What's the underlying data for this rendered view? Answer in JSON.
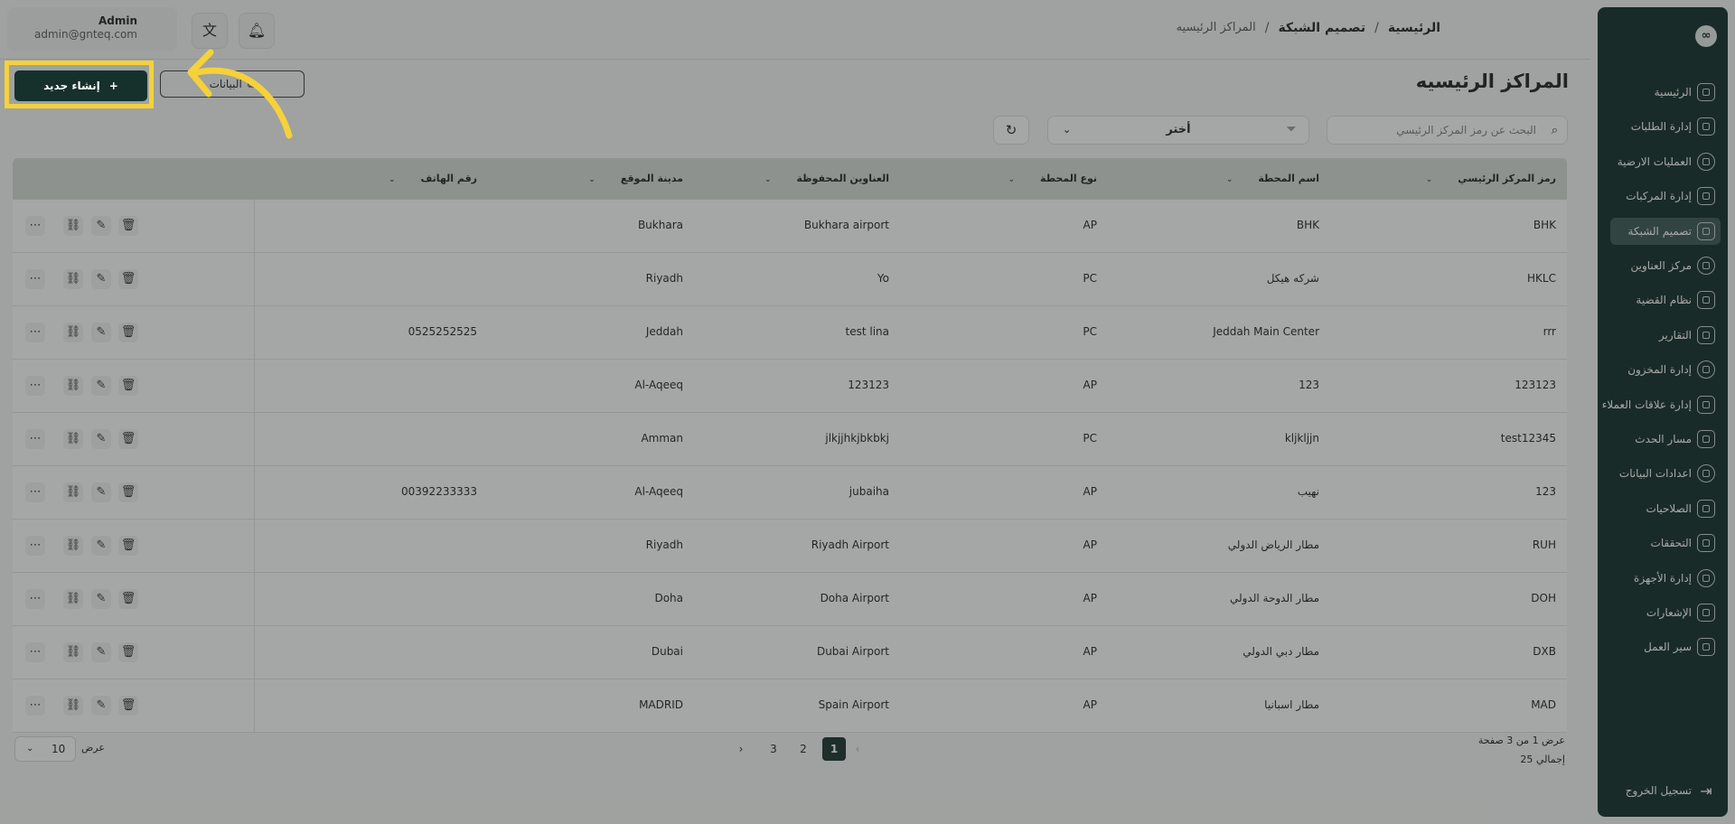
{
  "sidebar": {
    "logo": "∞",
    "items": [
      {
        "label": "الرئيسية",
        "icon": "dashboard-icon",
        "active": false
      },
      {
        "label": "إدارة الطلبات",
        "icon": "orders-icon",
        "active": false
      },
      {
        "label": "العمليات الارضية",
        "icon": "ground-ops-icon",
        "active": false
      },
      {
        "label": "إدارة المركبات",
        "icon": "truck-icon",
        "active": false
      },
      {
        "label": "تصميم الشبكة",
        "icon": "network-icon",
        "active": true
      },
      {
        "label": "مركز العناوين",
        "icon": "location-icon",
        "active": false
      },
      {
        "label": "نظام القضية",
        "icon": "case-icon",
        "active": false
      },
      {
        "label": "التقارير",
        "icon": "reports-icon",
        "active": false
      },
      {
        "label": "إدارة المخزون",
        "icon": "inventory-icon",
        "active": false
      },
      {
        "label": "إدارة علاقات العملاء",
        "icon": "crm-icon",
        "active": false
      },
      {
        "label": "مسار الحدث",
        "icon": "route-icon",
        "active": false
      },
      {
        "label": "اعدادات البيانات",
        "icon": "database-icon",
        "active": false
      },
      {
        "label": "الصلاحيات",
        "icon": "users-icon",
        "active": false
      },
      {
        "label": "التحققات",
        "icon": "tools-icon",
        "active": false
      },
      {
        "label": "إدارة الأجهزة",
        "icon": "devices-icon",
        "active": false
      },
      {
        "label": "الإشعارات",
        "icon": "bell-icon",
        "active": false
      },
      {
        "label": "سير العمل",
        "icon": "workflow-icon",
        "active": false
      }
    ],
    "logout": "تسجيل الخروج"
  },
  "header": {
    "user_name": "Admin",
    "user_email": "admin@gnteq.com",
    "breadcrumb": [
      "الرئيسية",
      "تصميم الشبكة",
      "المراكز الرئيسيه"
    ]
  },
  "page": {
    "title": "المراكز الرئيسيه",
    "create_label": "إنشاء جديد",
    "import_label": "البيانات"
  },
  "filters": {
    "search_placeholder": "البحث عن رمز المركز الرئيسي",
    "select_value": "أختر"
  },
  "table": {
    "columns": [
      "رمز المركز الرئيسي",
      "اسم المحطة",
      "نوع المحطة",
      "العناوين المحفوظة",
      "مدينة الموقع",
      "رقم الهاتف"
    ],
    "rows": [
      {
        "code": "BHK",
        "name": "BHK",
        "type": "AP",
        "address": "Bukhara airport",
        "city": "Bukhara",
        "phone": ""
      },
      {
        "code": "HKLC",
        "name": "شركه هيكل",
        "type": "PC",
        "address": "Yo",
        "city": "Riyadh",
        "phone": ""
      },
      {
        "code": "rrr",
        "name": "Jeddah Main Center",
        "type": "PC",
        "address": "test lina",
        "city": "Jeddah",
        "phone": "0525252525"
      },
      {
        "code": "123123",
        "name": "123",
        "type": "AP",
        "address": "123123",
        "city": "Al-Aqeeq",
        "phone": ""
      },
      {
        "code": "test12345",
        "name": "kljkljjn",
        "type": "PC",
        "address": "jlkjjhkjbkbkj",
        "city": "Amman",
        "phone": ""
      },
      {
        "code": "123",
        "name": "نهيب",
        "type": "AP",
        "address": "jubaiha",
        "city": "Al-Aqeeq",
        "phone": "00392233333"
      },
      {
        "code": "RUH",
        "name": "مطار الرياض الدولي",
        "type": "AP",
        "address": "Riyadh Airport",
        "city": "Riyadh",
        "phone": ""
      },
      {
        "code": "DOH",
        "name": "مطار الدوحة الدولي",
        "type": "AP",
        "address": "Doha Airport",
        "city": "Doha",
        "phone": ""
      },
      {
        "code": "DXB",
        "name": "مطار دبي الدولي",
        "type": "AP",
        "address": "Dubai Airport",
        "city": "Dubai",
        "phone": ""
      },
      {
        "code": "MAD",
        "name": "مطار اسبانيا",
        "type": "AP",
        "address": "Spain Airport",
        "city": "MADRID",
        "phone": ""
      }
    ]
  },
  "pagination": {
    "pages": [
      "1",
      "2",
      "3"
    ],
    "current": "1",
    "info_line1": "عرض 1 من 3 صفحة",
    "info_line2": "إجمالي 25",
    "per_page_label": "عرض",
    "per_page_value": "10"
  },
  "colors": {
    "sidebar_bg": "#0f2a26",
    "primary": "#16302b",
    "highlight": "#f5d13a"
  }
}
